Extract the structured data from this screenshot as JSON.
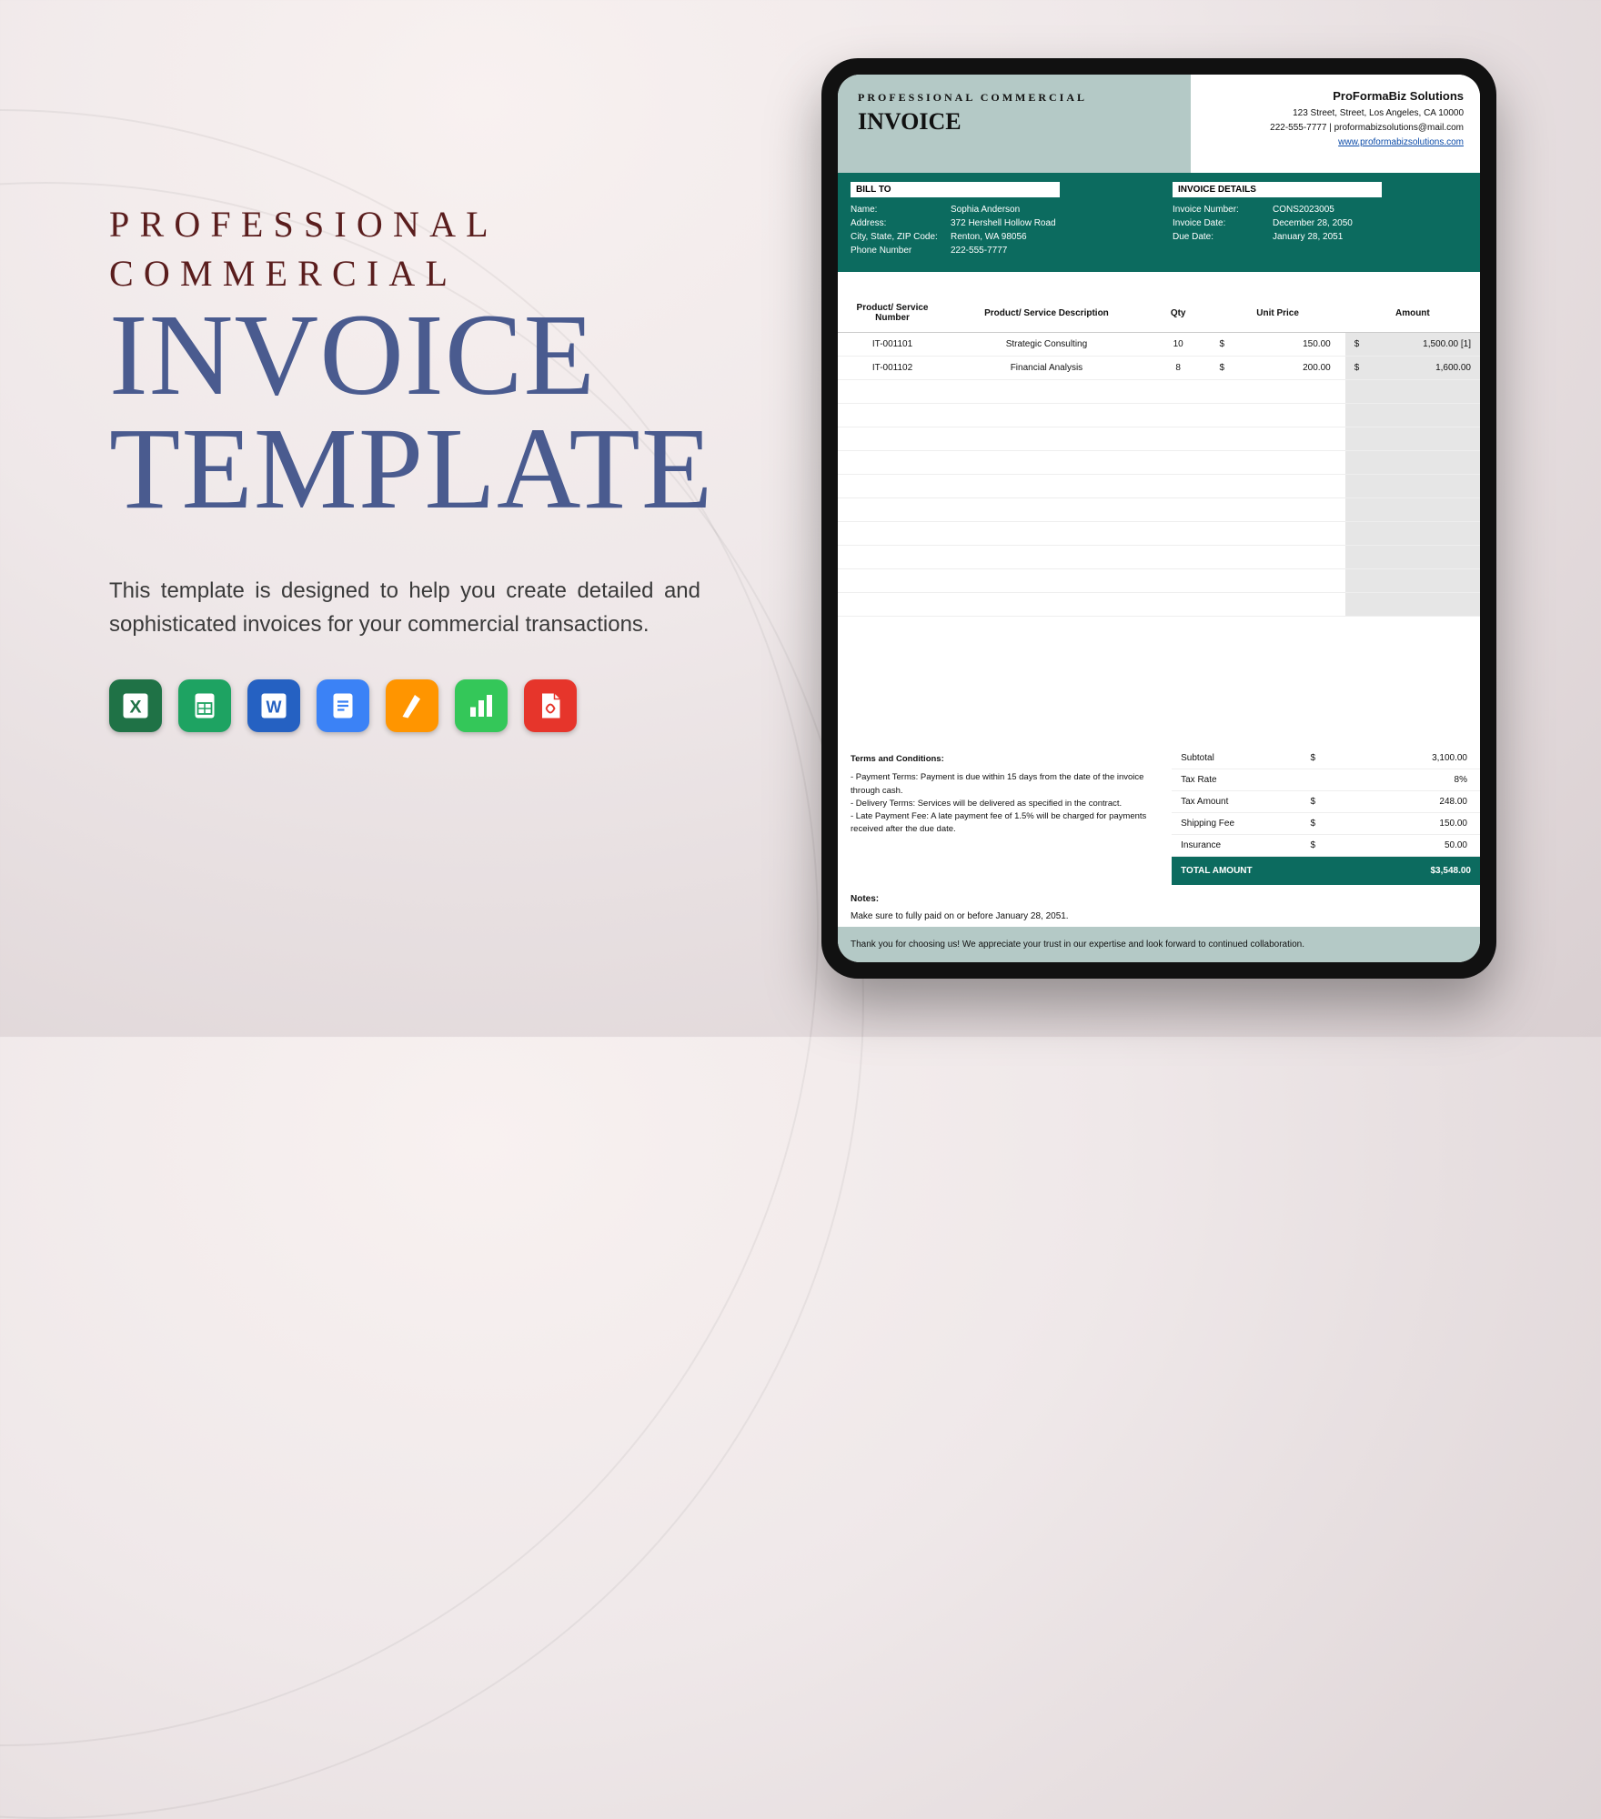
{
  "promo": {
    "line1": "PROFESSIONAL",
    "line2": "COMMERCIAL",
    "big1": "INVOICE",
    "big2": "TEMPLATE",
    "description": "This template is designed to help you create detailed and sophisticated invoices for your commercial transactions.",
    "apps": [
      "excel",
      "sheets",
      "word",
      "docs",
      "pages",
      "numbers",
      "pdf"
    ]
  },
  "invoice": {
    "header": {
      "line1": "PROFESSIONAL COMMERCIAL",
      "line2": "INVOICE",
      "company": "ProFormaBiz Solutions",
      "address": "123 Street, Street, Los Angeles, CA 10000",
      "contact": "222-555-7777  |  proformabizsolutions@mail.com",
      "website": "www.proformabizsolutions.com"
    },
    "bill_to": {
      "title": "BILL TO",
      "labels": {
        "name": "Name:",
        "address": "Address:",
        "csz": "City, State, ZIP Code:",
        "phone": "Phone Number"
      },
      "name": "Sophia Anderson",
      "address": "372 Hershell Hollow Road",
      "csz": "Renton, WA 98056",
      "phone": "222-555-7777"
    },
    "details": {
      "title": "INVOICE DETAILS",
      "labels": {
        "num": "Invoice Number:",
        "date": "Invoice Date:",
        "due": "Due Date:"
      },
      "num": "CONS2023005",
      "date": "December 28, 2050",
      "due": "January 28, 2051"
    },
    "columns": [
      "Product/ Service Number",
      "Product/ Service Description",
      "Qty",
      "Unit Price",
      "Amount"
    ],
    "line_note": "1,500.00   [1]",
    "rows": [
      {
        "num": "IT-001101",
        "desc": "Strategic Consulting",
        "qty": "10",
        "unit": "150.00",
        "amount": "1,500.00"
      },
      {
        "num": "IT-001102",
        "desc": "Financial Analysis",
        "qty": "8",
        "unit": "200.00",
        "amount": "1,600.00"
      }
    ],
    "empty_rows": 10,
    "terms": {
      "title": "Terms and Conditions:",
      "t1": "- Payment Terms: Payment is due within 15 days from the date of the invoice through cash.",
      "t2": "- Delivery Terms: Services will be delivered as specified in the contract.",
      "t3": "- Late Payment Fee: A late payment fee of 1.5% will be charged for payments received after the due date."
    },
    "summary": {
      "subtotal_l": "Subtotal",
      "subtotal_v": "3,100.00",
      "taxrate_l": "Tax Rate",
      "taxrate_v": "8%",
      "taxamt_l": "Tax Amount",
      "taxamt_v": "248.00",
      "ship_l": "Shipping Fee",
      "ship_v": "150.00",
      "ins_l": "Insurance",
      "ins_v": "50.00",
      "total_l": "TOTAL AMOUNT",
      "total_v": "$3,548.00"
    },
    "notes": {
      "title": "Notes:",
      "body": "Make sure to fully paid on or before January 28, 2051."
    },
    "thanks": "Thank you for choosing us! We appreciate your trust in our expertise and look forward to continued collaboration."
  }
}
